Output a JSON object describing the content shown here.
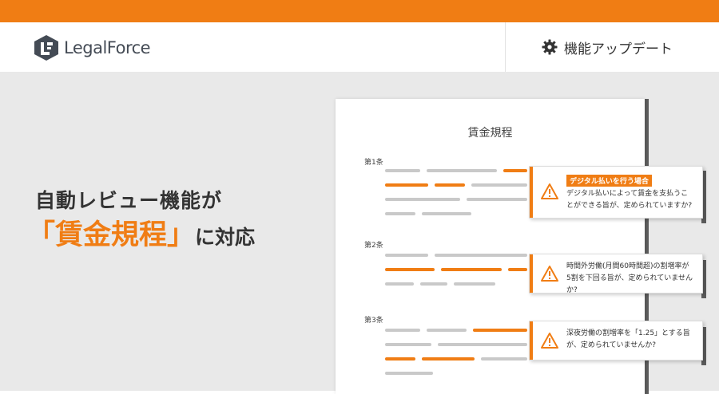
{
  "header": {
    "brand": "LegalForce",
    "update_label": "機能アップデート"
  },
  "hero": {
    "headline_line1": "自動レビュー機能が",
    "headline_bracket_open": "「",
    "headline_keyword": "賃金規程",
    "headline_bracket_close": "」",
    "headline_suffix": "に対応"
  },
  "document": {
    "title": "賃金規程",
    "articles": [
      {
        "label": "第1条"
      },
      {
        "label": "第2条"
      },
      {
        "label": "第3条"
      }
    ]
  },
  "callouts": [
    {
      "tag": "デジタル払いを行う場合",
      "text": "デジタル払いによって賃金を支払うことができる旨が、定められていますか?",
      "icon": "warning-icon"
    },
    {
      "tag": "",
      "text": "時間外労働(月間60時間超)の割増率が5割を下回る旨が、定められていませんか?",
      "icon": "warning-icon"
    },
    {
      "tag": "",
      "text": "深夜労働の割増率を「1.25」とする旨が、定められていませんか?",
      "icon": "warning-icon"
    }
  ],
  "colors": {
    "accent": "#f07d14",
    "text": "#333333",
    "background": "#e9e9e9"
  }
}
